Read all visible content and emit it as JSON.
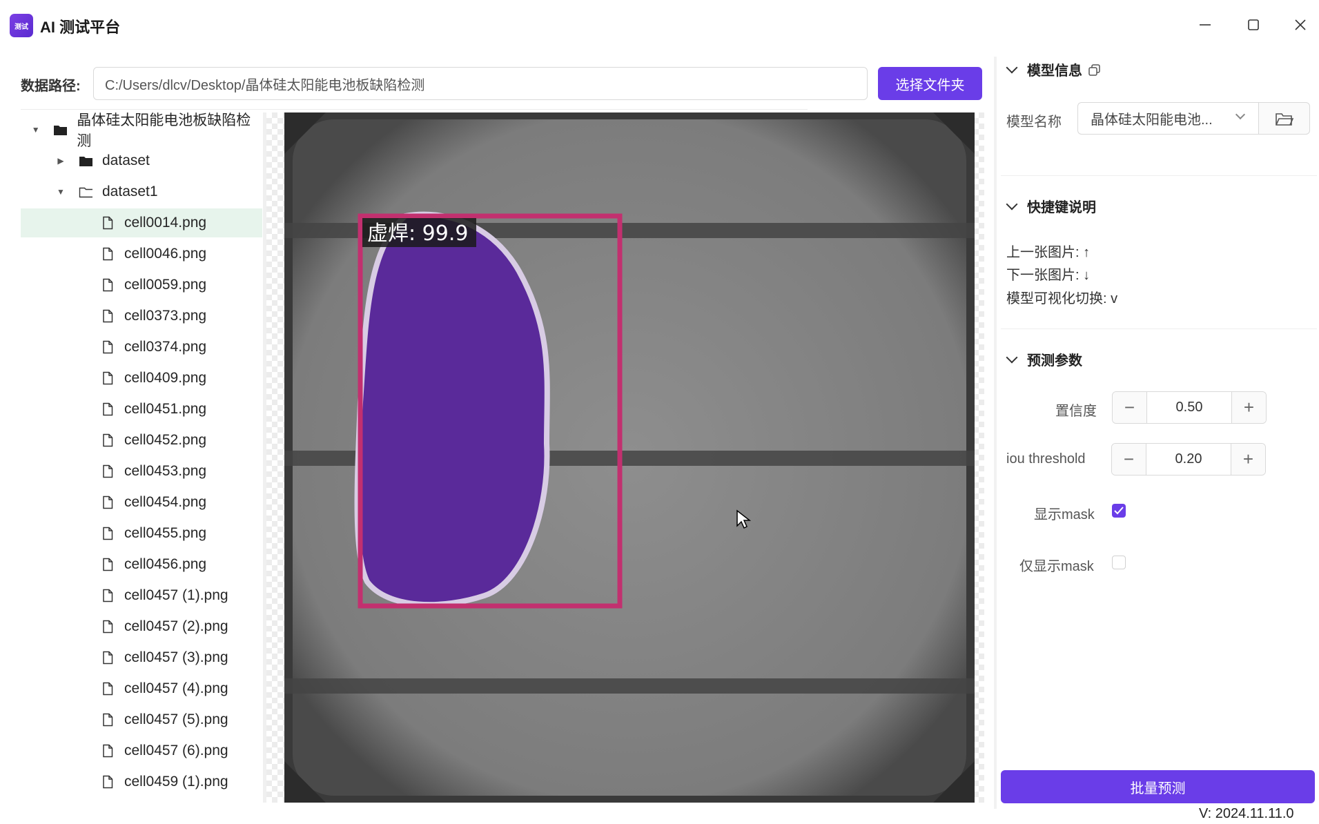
{
  "app": {
    "logo_text": "测试",
    "title": "AI 测试平台"
  },
  "path": {
    "label": "数据路径:",
    "value": "C:/Users/dlcv/Desktop/晶体硅太阳能电池板缺陷检测",
    "choose_button": "选择文件夹"
  },
  "tree": {
    "root": "晶体硅太阳能电池板缺陷检测",
    "folders": [
      "dataset",
      "dataset1"
    ],
    "files": [
      "cell0014.png",
      "cell0046.png",
      "cell0059.png",
      "cell0373.png",
      "cell0374.png",
      "cell0409.png",
      "cell0451.png",
      "cell0452.png",
      "cell0453.png",
      "cell0454.png",
      "cell0455.png",
      "cell0456.png",
      "cell0457 (1).png",
      "cell0457 (2).png",
      "cell0457 (3).png",
      "cell0457 (4).png",
      "cell0457 (5).png",
      "cell0457 (6).png",
      "cell0459 (1).png"
    ],
    "selected_file": "cell0014.png"
  },
  "detection": {
    "label": "虚焊: 99.9",
    "box_color": "#c2306f",
    "mask_color": "#5a2a9a"
  },
  "model_info": {
    "title": "模型信息",
    "name_label": "模型名称",
    "name_value": "晶体硅太阳能电池..."
  },
  "shortcuts": {
    "title": "快捷键说明",
    "prev": "上一张图片: ↑",
    "next": "下一张图片: ↓",
    "toggle": "模型可视化切换: v"
  },
  "params": {
    "title": "预测参数",
    "confidence_label": "置信度",
    "confidence_value": "0.50",
    "iou_label": "iou threshold",
    "iou_value": "0.20",
    "show_mask_label": "显示mask",
    "show_mask": true,
    "only_mask_label": "仅显示mask",
    "only_mask": false
  },
  "batch_button": "批量预测",
  "version": "V: 2024.11.11.0",
  "colors": {
    "accent": "#6a3de8",
    "selected_row": "#e7f4ec"
  }
}
